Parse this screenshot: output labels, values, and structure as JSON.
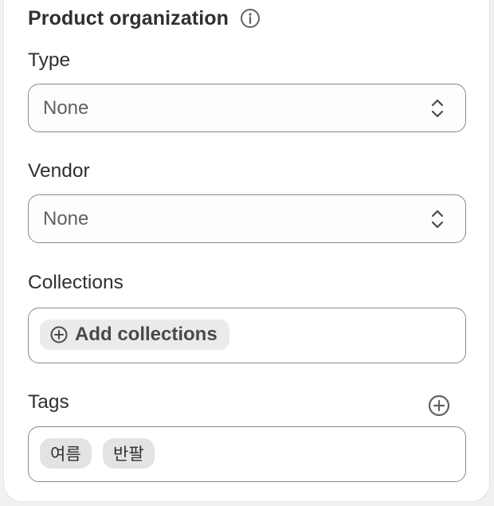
{
  "section": {
    "title": "Product organization",
    "info_icon": "info-icon"
  },
  "type": {
    "label": "Type",
    "value": "None",
    "icon": "select-chevrons-icon"
  },
  "vendor": {
    "label": "Vendor",
    "value": "None",
    "icon": "select-chevrons-icon"
  },
  "collections": {
    "label": "Collections",
    "add_label": "Add collections",
    "add_icon": "plus-circle-icon"
  },
  "tags": {
    "label": "Tags",
    "add_icon": "plus-circle-icon",
    "items": [
      "여름",
      "반팔"
    ]
  },
  "colors": {
    "text": "#303030",
    "muted_text": "#616161",
    "border": "#8a8a8a",
    "pill_bg": "#ebebeb",
    "tag_bg": "#e3e3e3"
  }
}
